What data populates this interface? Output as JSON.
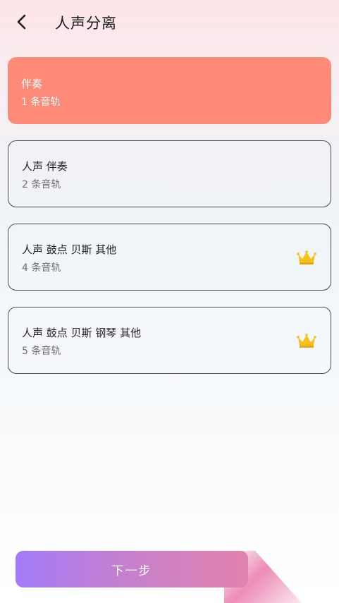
{
  "header": {
    "title": "人声分离",
    "back_icon": "chevron-left-icon"
  },
  "options": [
    {
      "title": "伴奏",
      "subtitle": "1 条音轨",
      "selected": true,
      "premium": false
    },
    {
      "title": "人声 伴奏",
      "subtitle": "2 条音轨",
      "selected": false,
      "premium": false
    },
    {
      "title": "人声 鼓点 贝斯 其他",
      "subtitle": "4 条音轨",
      "selected": false,
      "premium": true
    },
    {
      "title": "人声 鼓点 贝斯 钢琴 其他",
      "subtitle": "5 条音轨",
      "selected": false,
      "premium": true
    }
  ],
  "next_button": {
    "label": "下一步"
  },
  "colors": {
    "selected_card": "#ff8a78",
    "crown": "#f5c21b",
    "button_start": "#a37bfb",
    "button_end": "#e383ae"
  }
}
